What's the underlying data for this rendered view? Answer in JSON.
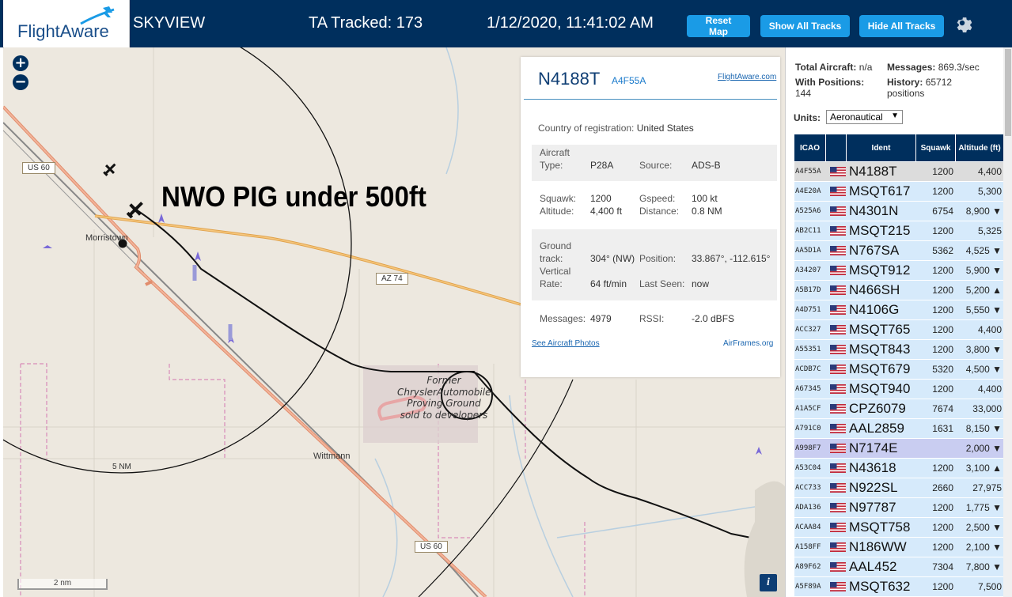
{
  "header": {
    "logo_text": "FlightAware",
    "app_name": "SKYVIEW",
    "tracked": "TA Tracked: 173",
    "datetime": "1/12/2020, 11:41:02 AM",
    "reset_label": "Reset Map",
    "show_label": "Show All Tracks",
    "hide_label": "Hide All Tracks",
    "gear_icon": "gear-icon"
  },
  "map": {
    "annotation": "NWO PIG under 500ft",
    "labels": {
      "town1": "Morristown",
      "town2": "Wittmann",
      "ring": "5 NM",
      "us60_a": "US 60",
      "us60_b": "US 60",
      "az74": "AZ 74",
      "scale": "2 nm",
      "proving": "Former ChryslerAutomobile Proving Ground sold to developers"
    },
    "zoom_in": "+",
    "zoom_out": "−",
    "info": "i"
  },
  "card": {
    "registration": "N4188T",
    "hex": "A4F55A",
    "fa_link": "FlightAware.com",
    "country_label": "Country of registration:",
    "country": "United States",
    "aircraft_type_label_1": "Aircraft",
    "aircraft_type_label_2": "Type:",
    "type": "P28A",
    "source_label": "Source:",
    "source": "ADS-B",
    "squawk_label": "Squawk:",
    "squawk": "1200",
    "gspeed_label": "Gspeed:",
    "gspeed": "100 kt",
    "altitude_label": "Altitude:",
    "altitude": "4,400 ft",
    "distance_label": "Distance:",
    "distance": "0.8 NM",
    "ground_label_1": "Ground",
    "ground_label_2": "track:",
    "track": "304° (NW)",
    "position_label": "Position:",
    "position": "33.867°, -112.615°",
    "vrate_label_1": "Vertical",
    "vrate_label_2": "Rate:",
    "vrate": "64 ft/min",
    "lastseen_label": "Last Seen:",
    "lastseen": "now",
    "messages_label": "Messages:",
    "messages": "4979",
    "rssi_label": "RSSI:",
    "rssi": "-2.0 dBFS",
    "photos_link": "See Aircraft Photos",
    "airframes_link": "AirFrames.org"
  },
  "panel": {
    "total_label": "Total Aircraft:",
    "total": "n/a",
    "messages_label": "Messages:",
    "messages": "869.3/sec",
    "positions_label": "With Positions:",
    "positions": "144",
    "history_label": "History:",
    "history": "65712",
    "history_unit": "positions",
    "units_label": "Units:",
    "units_value": "Aeronautical",
    "columns": [
      "ICAO",
      "",
      "Ident",
      "Squawk",
      "Altitude (ft)"
    ],
    "rows": [
      {
        "icao": "A4F55A",
        "ident": "N4188T",
        "squawk": "1200",
        "alt": "4,400"
      },
      {
        "icao": "A4E20A",
        "ident": "MSQT617",
        "squawk": "1200",
        "alt": "5,300"
      },
      {
        "icao": "A525A6",
        "ident": "N4301N",
        "squawk": "6754",
        "alt": "8,900 ▼"
      },
      {
        "icao": "AB2C11",
        "ident": "MSQT215",
        "squawk": "1200",
        "alt": "5,325"
      },
      {
        "icao": "AA5D1A",
        "ident": "N767SA",
        "squawk": "5362",
        "alt": "4,525 ▼"
      },
      {
        "icao": "A34207",
        "ident": "MSQT912",
        "squawk": "1200",
        "alt": "5,900 ▼"
      },
      {
        "icao": "A5B17D",
        "ident": "N466SH",
        "squawk": "1200",
        "alt": "5,200 ▲"
      },
      {
        "icao": "A4D751",
        "ident": "N4106G",
        "squawk": "1200",
        "alt": "5,550 ▼"
      },
      {
        "icao": "ACC327",
        "ident": "MSQT765",
        "squawk": "1200",
        "alt": "4,400"
      },
      {
        "icao": "A55351",
        "ident": "MSQT843",
        "squawk": "1200",
        "alt": "3,800 ▼"
      },
      {
        "icao": "ACDB7C",
        "ident": "MSQT679",
        "squawk": "5320",
        "alt": "4,500 ▼"
      },
      {
        "icao": "A67345",
        "ident": "MSQT940",
        "squawk": "1200",
        "alt": "4,400"
      },
      {
        "icao": "A1A5CF",
        "ident": "CPZ6079",
        "squawk": "7674",
        "alt": "33,000"
      },
      {
        "icao": "A791C0",
        "ident": "AAL2859",
        "squawk": "1631",
        "alt": "8,150 ▼"
      },
      {
        "icao": "A998F7",
        "ident": "N7174E",
        "squawk": "",
        "alt": "2,000 ▼"
      },
      {
        "icao": "A53C04",
        "ident": "N43618",
        "squawk": "1200",
        "alt": "3,100 ▲"
      },
      {
        "icao": "ACC733",
        "ident": "N922SL",
        "squawk": "2660",
        "alt": "27,975"
      },
      {
        "icao": "ADA136",
        "ident": "N97787",
        "squawk": "1200",
        "alt": "1,775 ▼"
      },
      {
        "icao": "ACAA84",
        "ident": "MSQT758",
        "squawk": "1200",
        "alt": "2,500 ▼"
      },
      {
        "icao": "A158FF",
        "ident": "N186WW",
        "squawk": "1200",
        "alt": "2,100 ▼"
      },
      {
        "icao": "A89F62",
        "ident": "AAL452",
        "squawk": "7304",
        "alt": "7,800 ▼"
      },
      {
        "icao": "A5F89A",
        "ident": "MSQT632",
        "squawk": "1200",
        "alt": "7,500"
      }
    ]
  },
  "colors": {
    "header_bg": "#002f5d",
    "button_bg": "#1a9be6",
    "row_bg": "#d6eafb",
    "selected_row_bg": "#dcdcdc",
    "alert_row_bg": "#c9cdf1"
  }
}
